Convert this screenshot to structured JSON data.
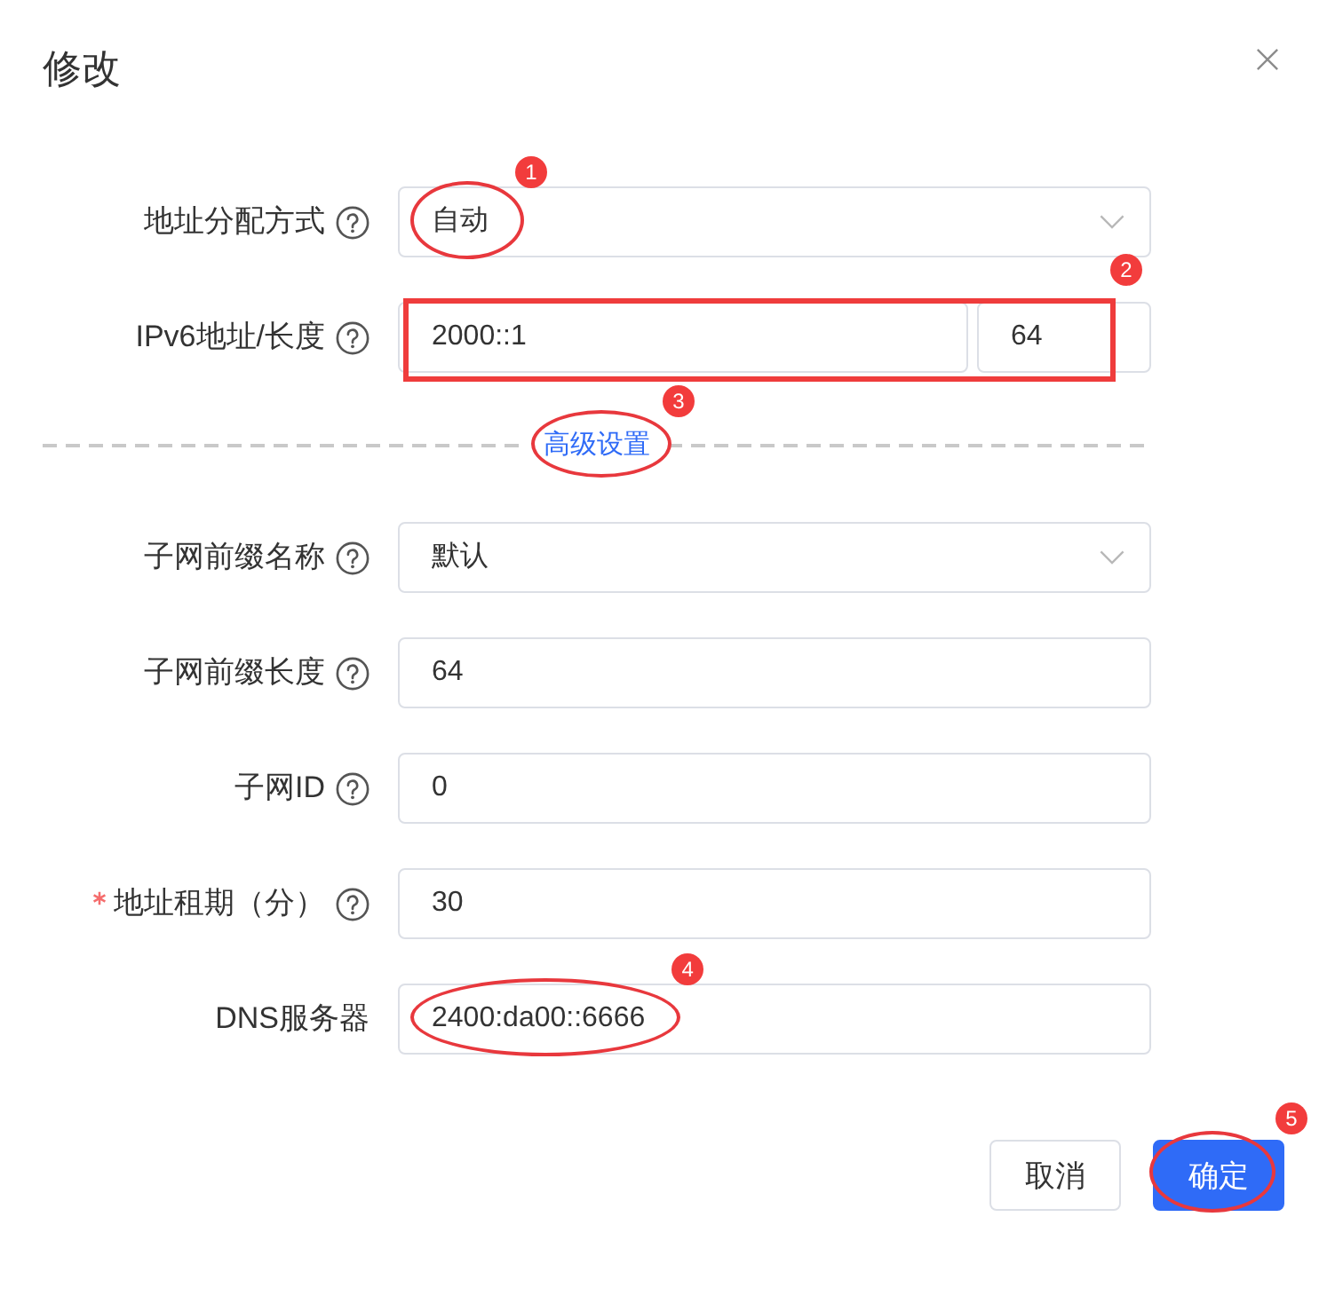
{
  "dialog": {
    "title": "修改"
  },
  "rows": [
    {
      "kind": "select",
      "label": "地址分配方式",
      "help": true,
      "required": false,
      "value": "自动",
      "annotation": {
        "kind": "ellipse",
        "number": "1"
      }
    },
    {
      "kind": "address",
      "label": "IPv6地址/长度",
      "help": true,
      "required": false,
      "value": "2000::1",
      "length": "64",
      "annotation": {
        "kind": "rectangle",
        "number": "2"
      }
    },
    {
      "kind": "divider",
      "link": "高级设置",
      "annotation": {
        "kind": "ellipse",
        "number": "3"
      }
    },
    {
      "kind": "select",
      "label": "子网前缀名称",
      "help": true,
      "required": false,
      "value": "默认"
    },
    {
      "kind": "input",
      "label": "子网前缀长度",
      "help": true,
      "required": false,
      "value": "64"
    },
    {
      "kind": "input",
      "label": "子网ID",
      "help": true,
      "required": false,
      "value": "0"
    },
    {
      "kind": "input",
      "label": "地址租期（分）",
      "help": true,
      "required": true,
      "value": "30"
    },
    {
      "kind": "input",
      "label": "DNS服务器",
      "help": false,
      "required": false,
      "value": "2400:da00::6666",
      "annotation": {
        "kind": "ellipse",
        "number": "4"
      }
    }
  ],
  "buttons": [
    {
      "kind": "default",
      "label": "取消"
    },
    {
      "kind": "primary",
      "label": "确定",
      "annotation": {
        "kind": "ellipse",
        "number": "5"
      }
    }
  ]
}
